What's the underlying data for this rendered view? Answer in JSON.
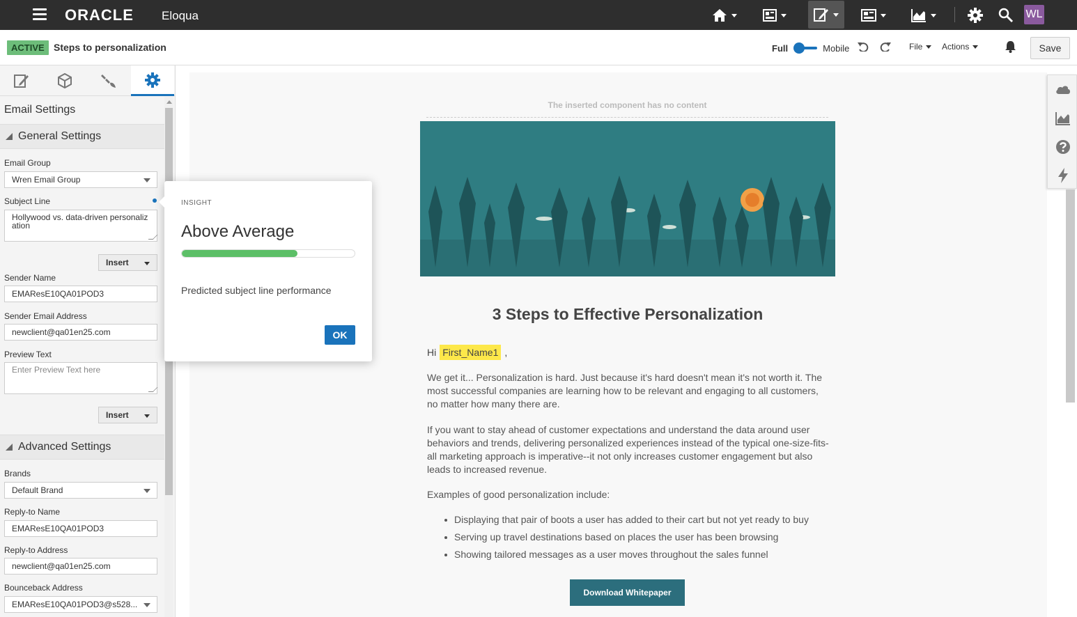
{
  "topbar": {
    "logo": "ORACLE",
    "product": "Eloqua",
    "avatar_initials": "WL",
    "icons": [
      "home-icon",
      "dashboard-icon",
      "edit-icon",
      "assets-icon",
      "chart-icon",
      "gear-icon",
      "search-icon"
    ]
  },
  "subbar": {
    "status": "ACTIVE",
    "title": "Steps to personalization",
    "view_full": "Full",
    "view_mobile": "Mobile",
    "file_menu": "File",
    "actions_menu": "Actions",
    "save_label": "Save"
  },
  "panel": {
    "title": "Email Settings",
    "general_section": "General Settings",
    "email_group_label": "Email Group",
    "email_group_value": "Wren Email Group",
    "subject_label": "Subject Line",
    "subject_value": "Hollywood vs. data-driven personaliz ation",
    "insert_label": "Insert",
    "sender_name_label": "Sender Name",
    "sender_name_value": "EMAResE10QA01POD3",
    "sender_email_label": "Sender Email Address",
    "sender_email_value": "newclient@qa01en25.com",
    "preview_label": "Preview Text",
    "preview_placeholder": "Enter Preview Text here",
    "advanced_section": "Advanced Settings",
    "brands_label": "Brands",
    "brands_value": "Default Brand",
    "reply_name_label": "Reply-to Name",
    "reply_name_value": "EMAResE10QA01POD3",
    "reply_address_label": "Reply-to Address",
    "reply_address_value": "newclient@qa01en25.com",
    "bounce_label": "Bounceback Address",
    "bounce_value": "EMAResE10QA01POD3@s528..."
  },
  "insight": {
    "kicker": "INSIGHT",
    "title": "Above Average",
    "progress": 0.67,
    "text": "Predicted subject line performance",
    "ok_label": "OK"
  },
  "email": {
    "empty_component": "The inserted component has no content",
    "heading": "3 Steps to Effective Personalization",
    "greeting": "Hi",
    "merge_field": "First_Name1",
    "greeting_suffix": ",",
    "para1": "We get it... Personalization is hard. Just because it's hard doesn't mean it's not worth it. The most successful companies are learning how to be relevant and engaging to all customers, no matter how many there are.",
    "para2": "If you want to stay ahead of customer expectations and understand the data around user behaviors and trends, delivering personalized experiences instead of the typical one-size-fits-all marketing approach is imperative--it not only increases customer engagement but also leads to increased revenue.",
    "para3": "Examples of good personalization include:",
    "bullets": [
      "Displaying that pair of boots a user has added to their cart but not yet ready to buy",
      "Serving up travel destinations based on places the user has been browsing",
      "Showing tailored messages as a user moves throughout the sales funnel"
    ],
    "cta": "Download Whitepaper"
  },
  "colors": {
    "accent": "#1a73bb",
    "active_badge": "#6dbd7a",
    "progress": "#5cbf67",
    "hero_bg": "#2f7d82",
    "cta": "#2c6e7d"
  }
}
